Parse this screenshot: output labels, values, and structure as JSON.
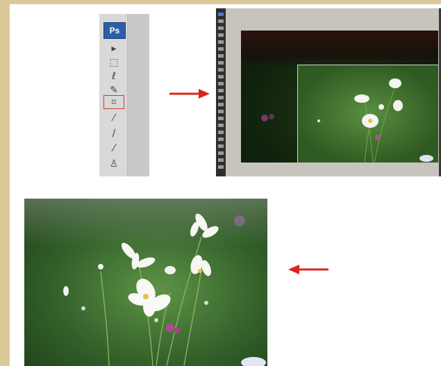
{
  "toolbox": {
    "logo": "Ps",
    "tools": [
      {
        "name": "move-tool-icon",
        "glyph": "▸"
      },
      {
        "name": "marquee-tool-icon",
        "glyph": "⬚"
      },
      {
        "name": "lasso-tool-icon",
        "glyph": "ℓ"
      },
      {
        "name": "magic-wand-tool-icon",
        "glyph": "✎"
      },
      {
        "name": "crop-tool-icon",
        "glyph": "⌗",
        "highlighted": true
      },
      {
        "name": "eyedropper-tool-icon",
        "glyph": "⁄"
      },
      {
        "name": "healing-brush-tool-icon",
        "glyph": "∕"
      },
      {
        "name": "brush-tool-icon",
        "glyph": "⁄"
      },
      {
        "name": "clone-stamp-tool-icon",
        "glyph": "♙"
      }
    ]
  },
  "colors": {
    "arrow": "#d8261e",
    "highlight": "#d8362f",
    "ps_blue": "#2c5fa8"
  },
  "arrows": [
    {
      "name": "arrow-right-icon",
      "direction": "right"
    },
    {
      "name": "arrow-left-icon",
      "direction": "left"
    }
  ]
}
